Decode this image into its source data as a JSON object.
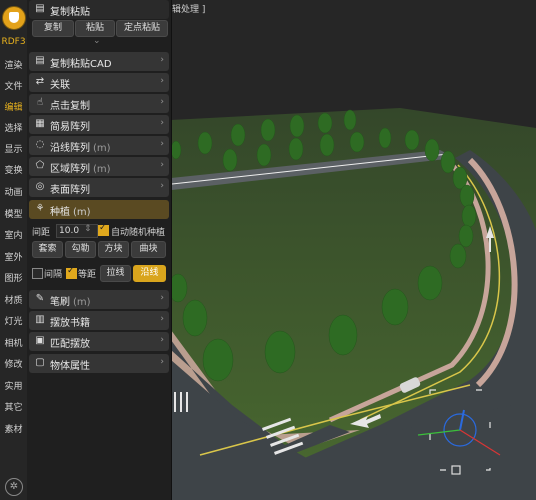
{
  "viewport": {
    "top_hint": "辑处理 ]"
  },
  "catbar": {
    "version": "RDF3",
    "items": [
      "渲染",
      "文件",
      "编辑",
      "选择",
      "显示",
      "变换",
      "动画",
      "模型",
      "室内",
      "室外",
      "图形",
      "材质",
      "灯光",
      "相机",
      "修改",
      "实用",
      "其它",
      "素材"
    ],
    "active_index": 2
  },
  "copypaste": {
    "title": "复制粘贴",
    "buttons": [
      "复制",
      "粘贴",
      "定点粘贴"
    ]
  },
  "rows": {
    "copy_cad": "复制粘贴CAD",
    "link": "关联",
    "click_copy": "点击复制",
    "simple_array": "简易阵列",
    "line_array": "沿线阵列",
    "line_array_unit": "(m)",
    "region_array": "区域阵列",
    "region_array_unit": "(m)",
    "surface_array": "表面阵列",
    "brush": "笔刷",
    "brush_unit": "(m)",
    "place_book": "摆放书籍",
    "match_place": "匹配摆放",
    "object_props": "物体属性"
  },
  "plant": {
    "title": "种植",
    "unit": "(m)",
    "spacing_label": "间距",
    "spacing_value": "10.0",
    "auto_random_label": "自动随机种植",
    "auto_random_checked": true,
    "buttons1": [
      "套索",
      "勾勒",
      "方块",
      "曲块"
    ],
    "interval_label": "间隔",
    "interval_checked": false,
    "equal_label": "等距",
    "equal_checked": true,
    "buttons2": [
      "拉线",
      "沿线"
    ],
    "buttons2_active": 1
  },
  "colors": {
    "accent": "#e0a81d",
    "grass": "#3f5a2c",
    "asphalt": "#3e4448"
  }
}
